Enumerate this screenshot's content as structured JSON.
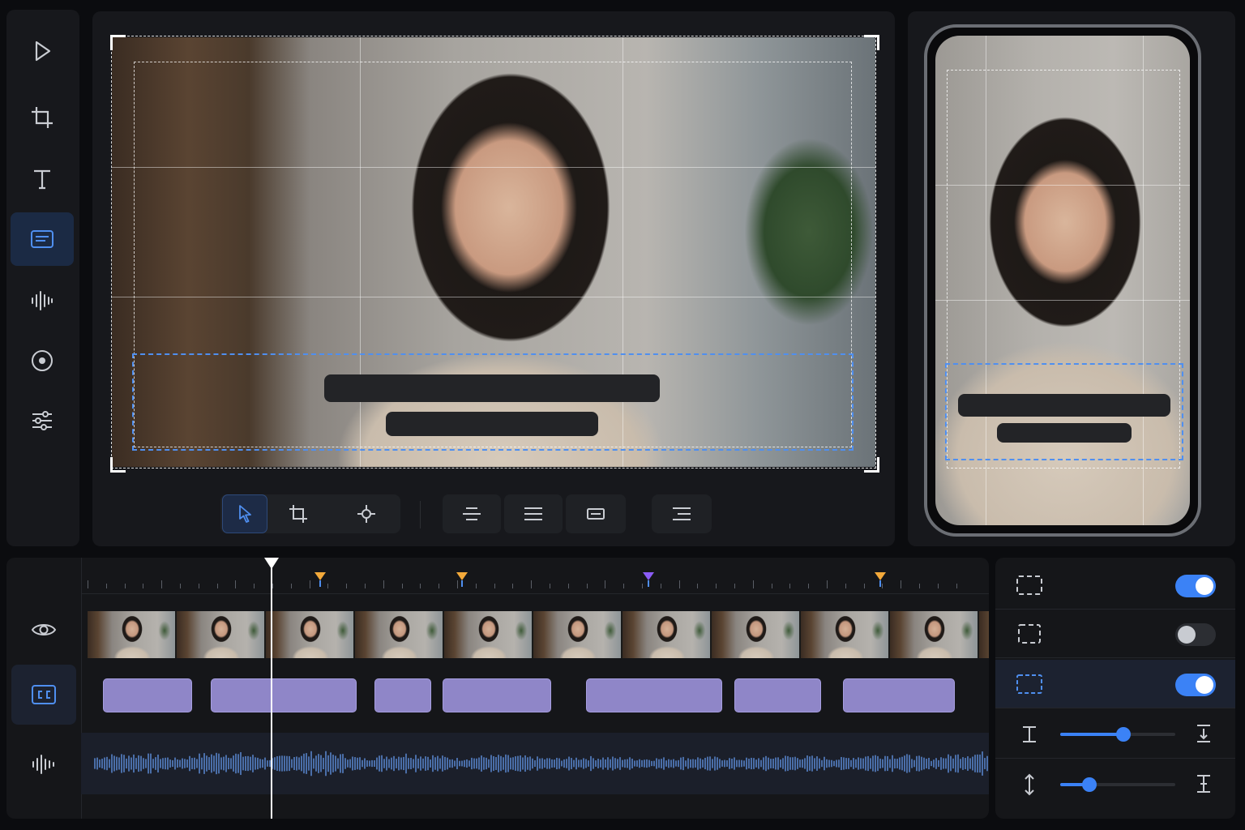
{
  "left_toolbar": {
    "tools": [
      {
        "icon": "play-icon",
        "active": false
      },
      {
        "icon": "crop-icon",
        "active": false
      },
      {
        "icon": "text-icon",
        "active": false
      },
      {
        "icon": "captions-icon",
        "active": true
      },
      {
        "icon": "audio-waveform-icon",
        "active": false
      },
      {
        "icon": "record-icon",
        "active": false
      },
      {
        "icon": "sliders-icon",
        "active": false
      }
    ]
  },
  "preview_toolbar": {
    "tools": [
      "select-cursor-icon",
      "crop-icon",
      "reframe-target-icon"
    ],
    "align": [
      "align-center-icon",
      "align-justify-icon",
      "fit-width-icon"
    ],
    "extra": [
      "align-lines-icon"
    ],
    "active_tool": "select-cursor-icon"
  },
  "timeline": {
    "tracks": [
      {
        "icon": "eye-icon",
        "active": false
      },
      {
        "icon": "cc-icon",
        "active": true
      },
      {
        "icon": "audio-wave-icon",
        "active": false
      }
    ],
    "marker_colors": [
      "#f3a93a",
      "#f3a93a",
      "#8b5cf6",
      "#f3a93a"
    ],
    "caption_clip_count": 7
  },
  "settings": {
    "toggles": [
      {
        "icon": "safe-area-icon",
        "on": true
      },
      {
        "icon": "title-safe-icon",
        "on": false
      },
      {
        "icon": "caption-zone-icon",
        "on": true
      }
    ],
    "sliders": [
      {
        "icon": "line-spacing-icon",
        "end_icon": "align-bottom-icon",
        "value": 0.55
      },
      {
        "icon": "vertical-position-icon",
        "end_icon": "vertical-align-icon",
        "value": 0.25
      }
    ]
  },
  "colors": {
    "accent": "#3b82f6",
    "caption_clip": "#8f86c8",
    "marker_orange": "#f3a93a",
    "marker_purple": "#8b5cf6",
    "background": "#0b0c0f",
    "panel": "#17181c"
  }
}
